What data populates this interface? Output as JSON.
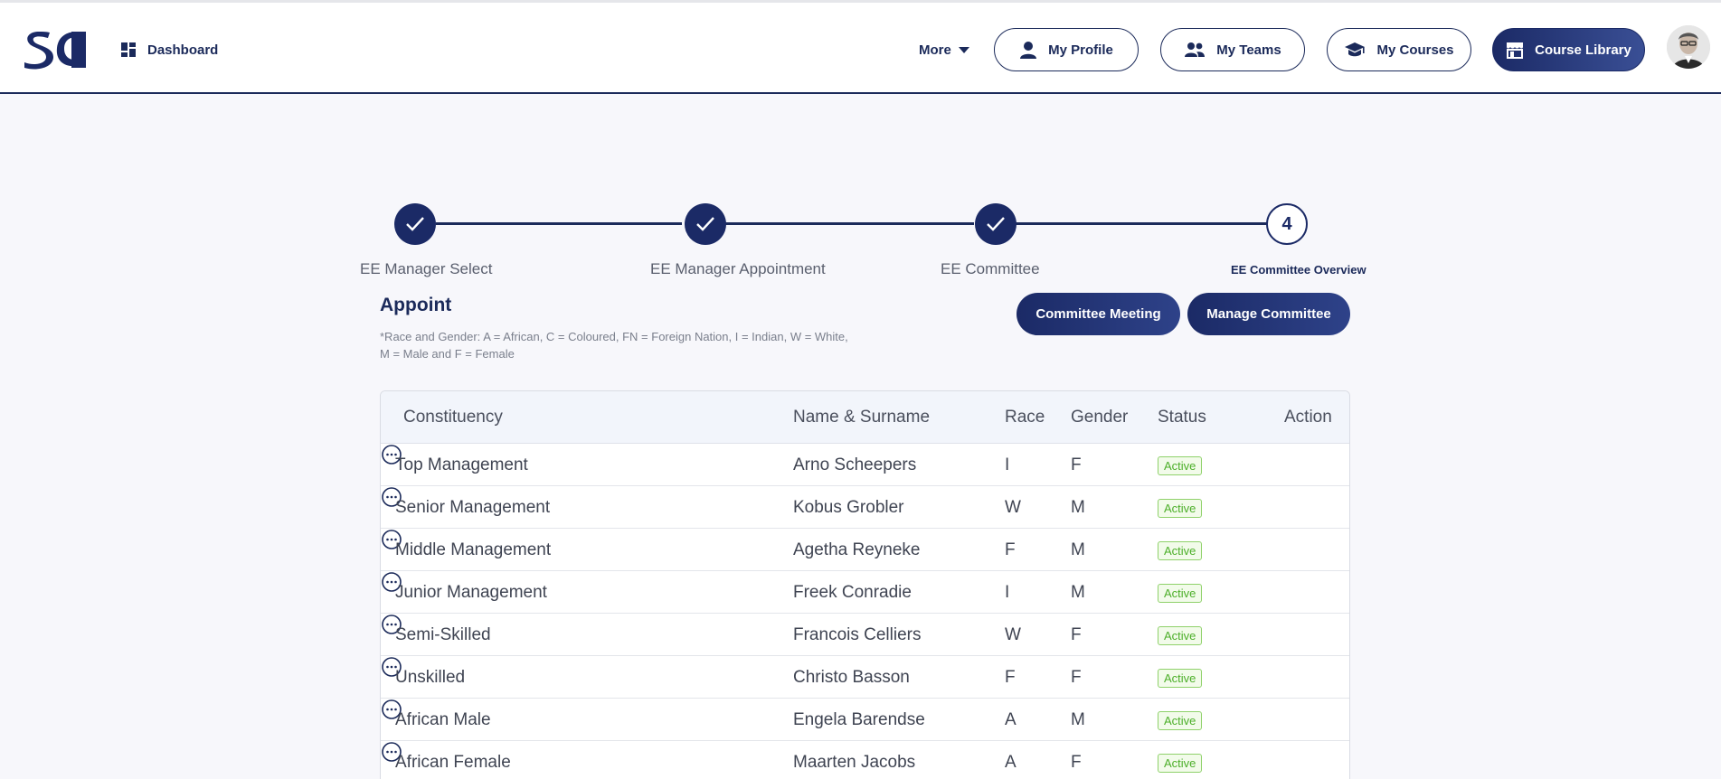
{
  "header": {
    "nav": {
      "dashboard": "Dashboard",
      "more": "More"
    },
    "buttons": {
      "my_profile": "My Profile",
      "my_teams": "My Teams",
      "my_courses": "My Courses",
      "course_library": "Course Library"
    }
  },
  "stepper": {
    "steps": [
      {
        "label": "EE Manager Select",
        "state": "done"
      },
      {
        "label": "EE Manager Appointment",
        "state": "done"
      },
      {
        "label": "EE Committee",
        "state": "done"
      },
      {
        "label": "EE Committee Overview",
        "state": "current",
        "number": "4"
      }
    ]
  },
  "section": {
    "title": "Appoint",
    "note": "*Race and Gender: A = African, C = Coloured, FN = Foreign Nation, I = Indian, W = White, M = Male and F = Female",
    "buttons": {
      "committee_meeting": "Committee Meeting",
      "manage_committee": "Manage Committee"
    }
  },
  "table": {
    "headers": [
      "Constituency",
      "Name & Surname",
      "Race",
      "Gender",
      "Status",
      "Action"
    ],
    "rows": [
      [
        "Top Management",
        "Arno Scheepers",
        "I",
        "F",
        "Active"
      ],
      [
        "Senior Management",
        "Kobus Grobler",
        "W",
        "M",
        "Active"
      ],
      [
        "Middle Management",
        "Agetha Reyneke",
        "F",
        "M",
        "Active"
      ],
      [
        "Junior Management",
        "Freek Conradie",
        "I",
        "M",
        "Active"
      ],
      [
        "Semi-Skilled",
        "Francois Celliers",
        "W",
        "F",
        "Active"
      ],
      [
        "Unskilled",
        "Christo Basson",
        "F",
        "F",
        "Active"
      ],
      [
        "African Male",
        "Engela Barendse",
        "A",
        "M",
        "Active"
      ],
      [
        "African Female",
        "Maarten Jacobs",
        "A",
        "F",
        "Active"
      ]
    ]
  },
  "colors": {
    "navy": "#1b2a5a",
    "accent": "#1b2a66",
    "active_green": "#4caf29"
  }
}
